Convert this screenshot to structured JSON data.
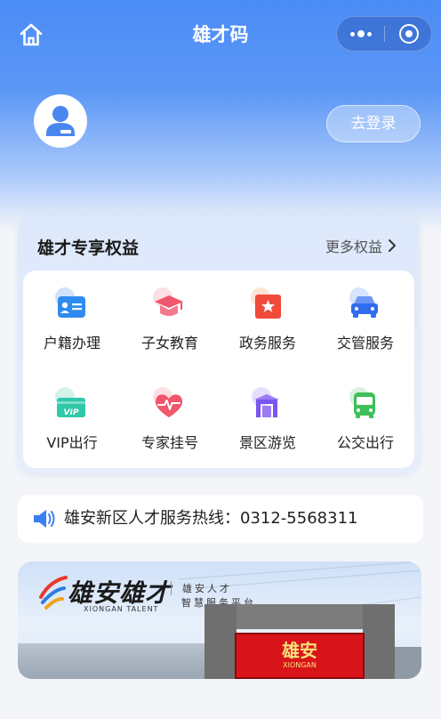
{
  "header": {
    "title": "雄才码",
    "home_icon": "home-icon",
    "more_icon": "more-dots-icon",
    "close_icon": "mini-program-close-icon"
  },
  "user": {
    "avatar_icon": "user-avatar-icon",
    "login_label": "去登录"
  },
  "benefits": {
    "title": "雄才专享权益",
    "more_label": "更多权益",
    "items": [
      {
        "label": "户籍办理",
        "icon": "id-card-icon",
        "color": "#2e8cf0"
      },
      {
        "label": "子女教育",
        "icon": "graduation-cap-icon",
        "color": "#f0566c"
      },
      {
        "label": "政务服务",
        "icon": "star-badge-icon",
        "color": "#f04a3a"
      },
      {
        "label": "交管服务",
        "icon": "car-icon",
        "color": "#2f6cf0"
      },
      {
        "label": "VIP出行",
        "icon": "vip-ticket-icon",
        "color": "#2fc8a8"
      },
      {
        "label": "专家挂号",
        "icon": "heart-pulse-icon",
        "color": "#f0566c"
      },
      {
        "label": "景区游览",
        "icon": "gate-icon",
        "color": "#7a55ef"
      },
      {
        "label": "公交出行",
        "icon": "bus-icon",
        "color": "#3fbf5a"
      }
    ]
  },
  "hotline": {
    "icon": "speaker-icon",
    "text": "雄安新区人才服务热线：0312-5568311"
  },
  "banner": {
    "logo_text": "雄安雄才",
    "logo_sub": "XIONGAN TALENT",
    "slogan_line1": "雄安人才",
    "slogan_line2": "智慧服务平台",
    "gate_sign": "雄安",
    "gate_sign_sub": "XIONGAN"
  }
}
